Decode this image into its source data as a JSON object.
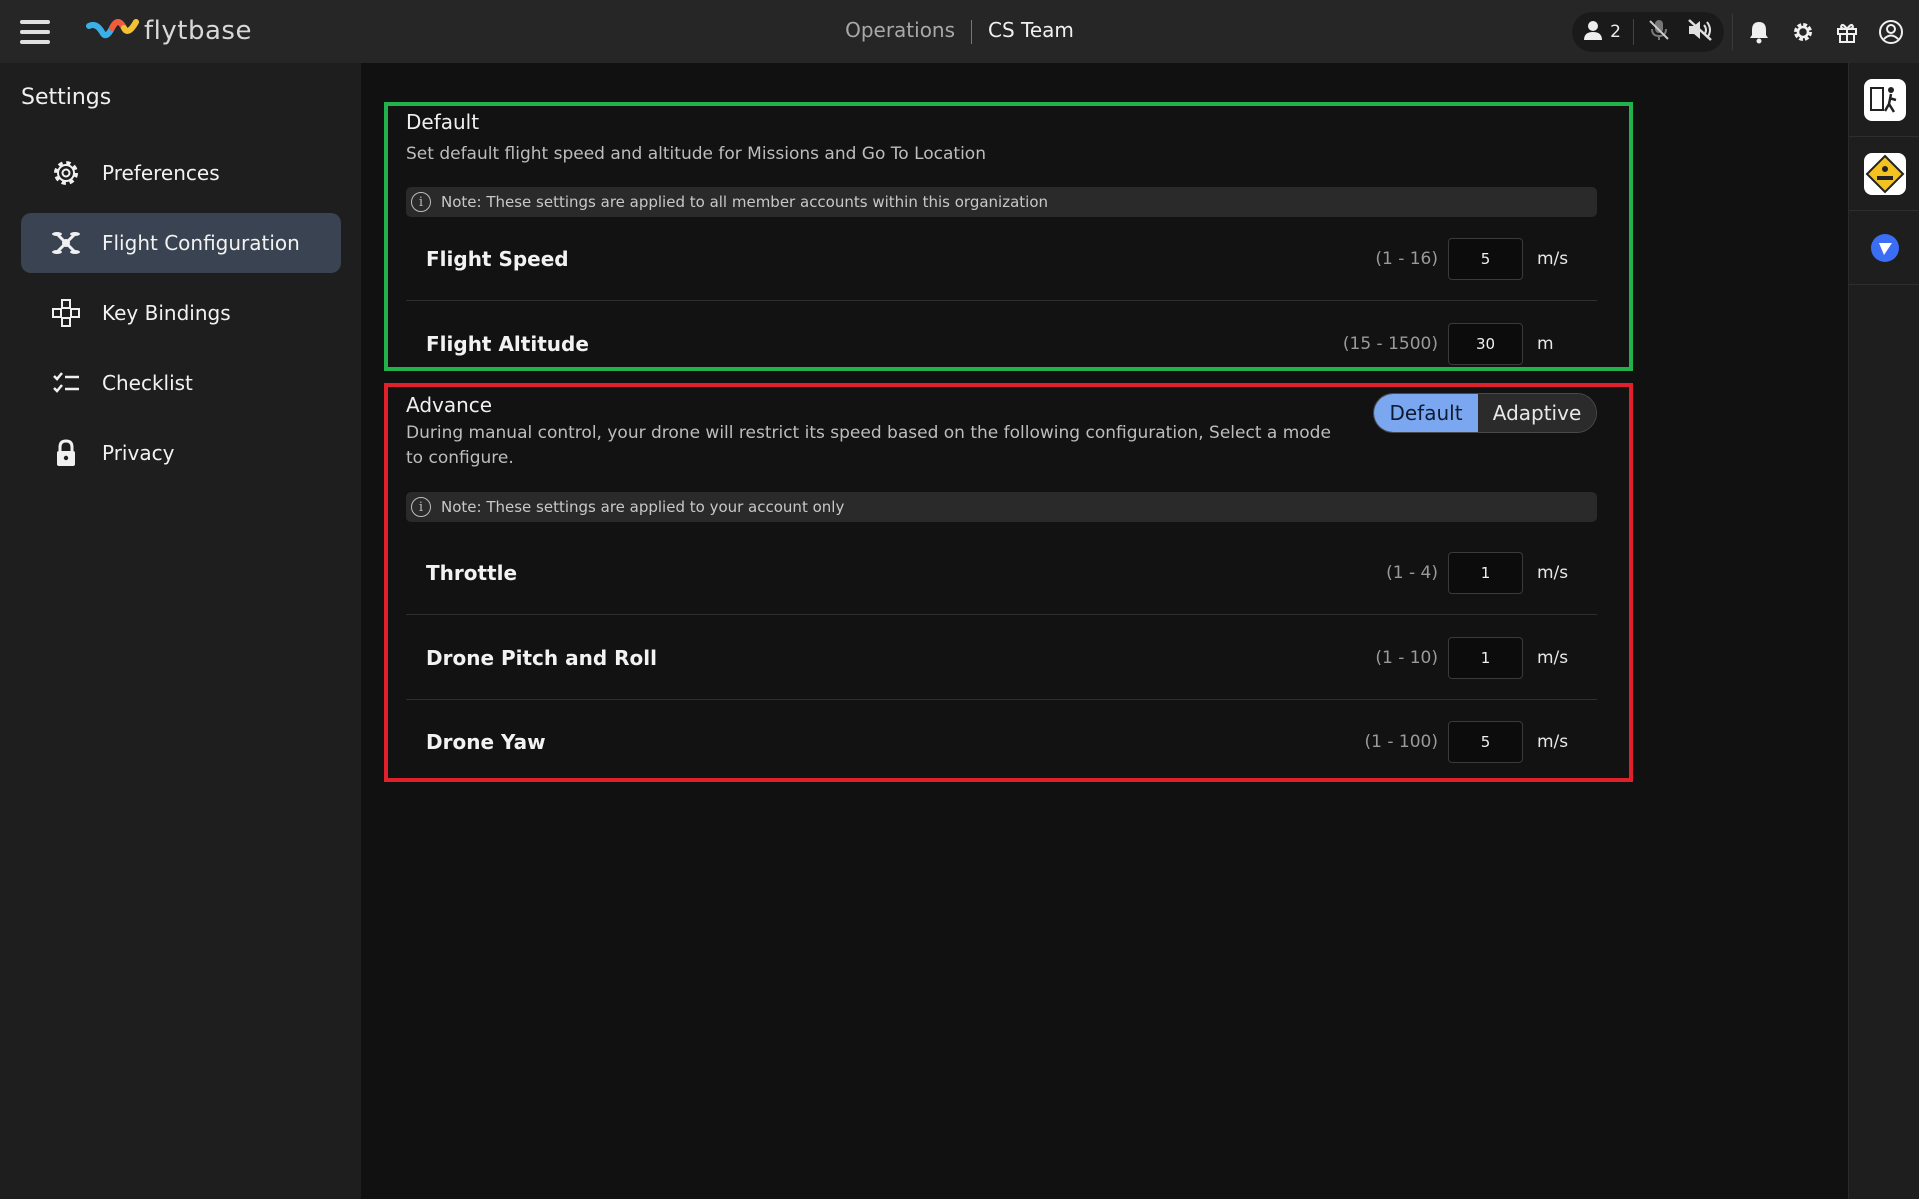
{
  "app": {
    "brand": "flytbase"
  },
  "header": {
    "breadcrumb_operations": "Operations",
    "breadcrumb_team": "CS Team",
    "user_count": "2"
  },
  "sidebar": {
    "title": "Settings",
    "items": [
      {
        "label": "Preferences",
        "icon": "gear-icon"
      },
      {
        "label": "Flight Configuration",
        "icon": "drone-icon",
        "active": true
      },
      {
        "label": "Key Bindings",
        "icon": "key-bindings-icon"
      },
      {
        "label": "Checklist",
        "icon": "checklist-icon"
      },
      {
        "label": "Privacy",
        "icon": "lock-icon"
      }
    ]
  },
  "default_section": {
    "title": "Default",
    "description": "Set default flight speed and altitude for Missions and Go To Location",
    "note": "Note: These settings are applied to all member accounts within this organization",
    "rows": [
      {
        "label": "Flight Speed",
        "range": "(1 - 16)",
        "value": "5",
        "unit": "m/s"
      },
      {
        "label": "Flight Altitude",
        "range": "(15 - 1500)",
        "value": "30",
        "unit": "m"
      }
    ]
  },
  "advance_section": {
    "title": "Advance",
    "description": "During manual control, your drone will restrict its speed based on the following configuration, Select a mode to configure.",
    "toggle": {
      "option_default": "Default",
      "option_adaptive": "Adaptive",
      "selected": "Default"
    },
    "note": "Note: These settings are applied to your account only",
    "rows": [
      {
        "label": "Throttle",
        "range": "(1 - 4)",
        "value": "1",
        "unit": "m/s"
      },
      {
        "label": "Drone Pitch and Roll",
        "range": "(1 - 10)",
        "value": "1",
        "unit": "m/s"
      },
      {
        "label": "Drone Yaw",
        "range": "(1 - 100)",
        "value": "5",
        "unit": "m/s"
      }
    ]
  },
  "colors": {
    "default_border": "#22b24c",
    "advance_border": "#e0202a",
    "toggle_active": "#7ba7f0",
    "nav_active": "#3a4352"
  }
}
